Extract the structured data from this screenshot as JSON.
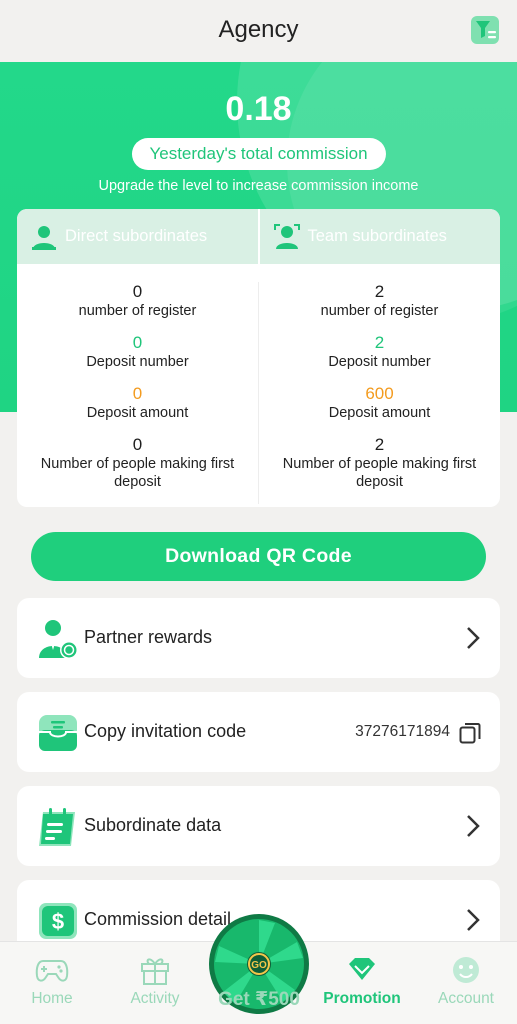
{
  "header": {
    "title": "Agency",
    "filter_icon": "filter-list-icon"
  },
  "hero": {
    "commission_value": "0.18",
    "commission_label": "Yesterday's total commission",
    "upgrade_note": "Upgrade the level to increase commission income"
  },
  "stats": {
    "direct": {
      "title": "Direct subordinates",
      "register_value": "0",
      "register_label": "number of register",
      "deposit_number_value": "0",
      "deposit_number_label": "Deposit number",
      "deposit_amount_value": "0",
      "deposit_amount_label": "Deposit amount",
      "first_deposit_value": "0",
      "first_deposit_label": "Number of people making first deposit"
    },
    "team": {
      "title": "Team subordinates",
      "register_value": "2",
      "register_label": "number of register",
      "deposit_number_value": "2",
      "deposit_number_label": "Deposit number",
      "deposit_amount_value": "600",
      "deposit_amount_label": "Deposit amount",
      "first_deposit_value": "2",
      "first_deposit_label": "Number of people making first deposit"
    }
  },
  "qr_button": {
    "label": "Download QR Code"
  },
  "menu": {
    "partner_rewards": "Partner rewards",
    "copy_invitation": "Copy invitation code",
    "invitation_code": "37276171894",
    "subordinate_data": "Subordinate data",
    "commission_detail": "Commission detail"
  },
  "tabbar": {
    "home": "Home",
    "activity": "Activity",
    "get": "Get ₹500",
    "promotion": "Promotion",
    "account": "Account"
  },
  "colors": {
    "accent": "#1fcf7d",
    "orange": "#f39b1f",
    "inactive": "#9ad8b9"
  }
}
